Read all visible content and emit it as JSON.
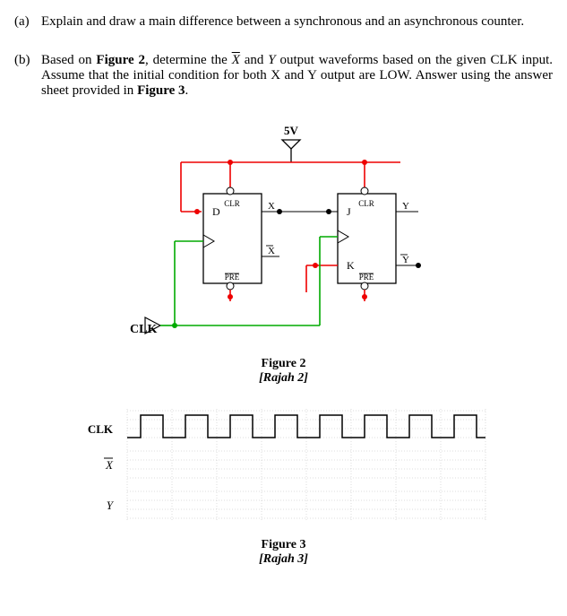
{
  "qa": {
    "label": "(a)",
    "text": "Explain and draw a main difference between a synchronous and an asynchronous counter."
  },
  "qb": {
    "label": "(b)",
    "pre": "Based on ",
    "fig2ref": "Figure 2",
    "mid1": ", determine the ",
    "xbar": "X",
    "mid2": " and ",
    "yvar": "Y",
    "mid3": " output waveforms based on the given CLK input. Assume that the initial condition for both X and Y output are LOW. Answer using the answer sheet provided in ",
    "fig3ref": "Figure 3",
    "end": "."
  },
  "circuit": {
    "vcc": "5V",
    "ff1": {
      "D": "D",
      "CLR": "CLR",
      "PRE": "PRE",
      "Q": "X",
      "Qb": "X"
    },
    "ff2": {
      "J": "J",
      "K": "K",
      "CLR": "CLR",
      "PRE": "PRE",
      "Q": "Y",
      "Qb": "Y"
    },
    "clk": "CLK"
  },
  "fig2": {
    "title": "Figure 2",
    "sub": "[Rajah 2]"
  },
  "timing": {
    "clk": "CLK",
    "xbar": "X",
    "y": "Y"
  },
  "fig3": {
    "title": "Figure 3",
    "sub": "[Rajah 3]"
  }
}
